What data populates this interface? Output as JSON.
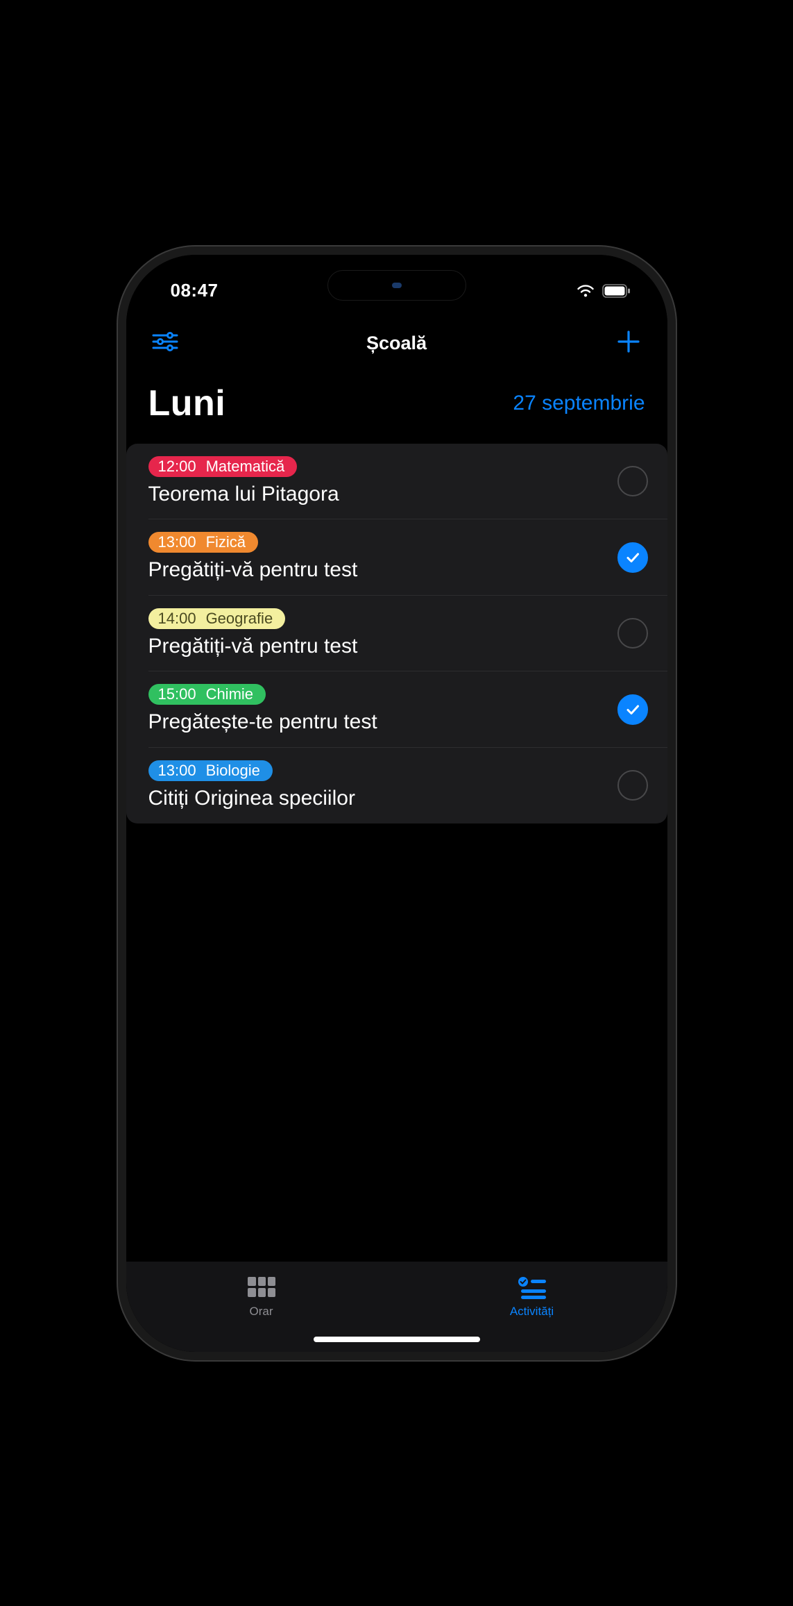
{
  "status": {
    "time": "08:47"
  },
  "nav": {
    "title": "Școală"
  },
  "header": {
    "day": "Luni",
    "date": "27 septembrie"
  },
  "colors": {
    "accent": "#0a84ff",
    "badges": {
      "math": "#e6264c",
      "physics": "#f0892f",
      "geography": "#f3ef9f",
      "chemistry": "#30c060",
      "biology": "#1f8fe6"
    }
  },
  "tasks": [
    {
      "time": "12:00",
      "subject": "Matematică",
      "title": "Teorema lui Pitagora",
      "color": "#e6264c",
      "textColor": "#fff",
      "checked": false
    },
    {
      "time": "13:00",
      "subject": "Fizică",
      "title": "Pregătiți-vă pentru test",
      "color": "#f0892f",
      "textColor": "#fff",
      "checked": true
    },
    {
      "time": "14:00",
      "subject": "Geografie",
      "title": "Pregătiți-vă pentru test",
      "color": "#f3ef9f",
      "textColor": "#4a4a20",
      "checked": false
    },
    {
      "time": "15:00",
      "subject": "Chimie",
      "title": "Pregătește-te pentru test",
      "color": "#30c060",
      "textColor": "#fff",
      "checked": true
    },
    {
      "time": "13:00",
      "subject": "Biologie",
      "title": "Citiți Originea speciilor",
      "color": "#1f8fe6",
      "textColor": "#fff",
      "checked": false
    }
  ],
  "tabs": [
    {
      "label": "Orar",
      "active": false
    },
    {
      "label": "Activități",
      "active": true
    }
  ]
}
